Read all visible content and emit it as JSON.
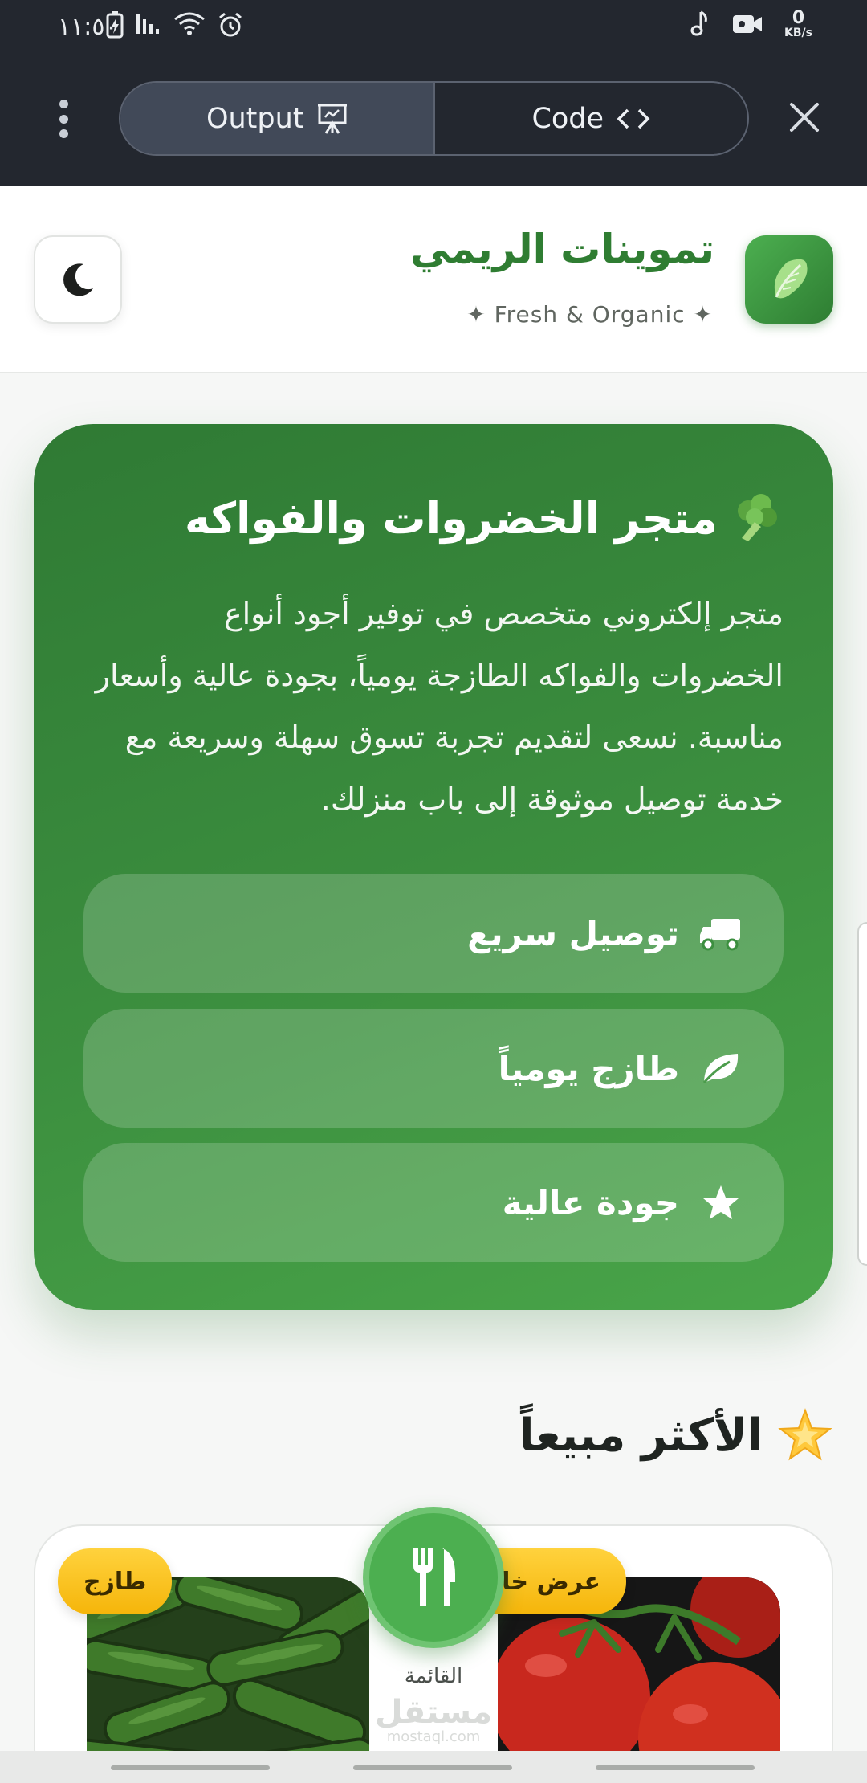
{
  "status": {
    "time": "١١:٥٠",
    "net_speed_value": "0",
    "net_speed_unit": "KB/s"
  },
  "viewer": {
    "tabs": [
      {
        "label": "Output",
        "icon": "presentation-icon"
      },
      {
        "label": "Code",
        "icon": "code-icon"
      }
    ],
    "active_tab": "Output"
  },
  "header": {
    "title": "تموينات الريمي",
    "tagline": "✦ Fresh & Organic ✦",
    "logo_icon": "lettuce-icon",
    "theme_icon": "moon-icon"
  },
  "hero": {
    "title": "متجر الخضروات والفواكه",
    "title_icon": "broccoli-icon",
    "description": "متجر إلكتروني متخصص في توفير أجود أنواع الخضروات والفواكه الطازجة يومياً، بجودة عالية وأسعار مناسبة. نسعى لتقديم تجربة تسوق سهلة وسريعة مع خدمة توصيل موثوقة إلى باب منزلك.",
    "features": [
      {
        "label": "توصيل سريع",
        "icon": "truck-icon"
      },
      {
        "label": "طازج يومياً",
        "icon": "leaf-icon"
      },
      {
        "label": "جودة عالية",
        "icon": "star-icon"
      }
    ]
  },
  "best_sellers": {
    "title": "الأكثر مبيعاً",
    "title_icon": "glowing-star-icon",
    "products": [
      {
        "badge": "عرض خاص",
        "image": "tomatoes"
      },
      {
        "badge": "طازج",
        "image": "cucumbers"
      }
    ]
  },
  "menu_button": {
    "label": "القائمة",
    "icon": "fork-knife-icon"
  },
  "watermark": {
    "text": "مستقل",
    "subtext": "mostaql.com"
  },
  "colors": {
    "brand_green": "#2f7d32",
    "hero_green": "#3c8f3f",
    "badge_yellow": "#f5b50a",
    "topbar": "#23272f"
  }
}
